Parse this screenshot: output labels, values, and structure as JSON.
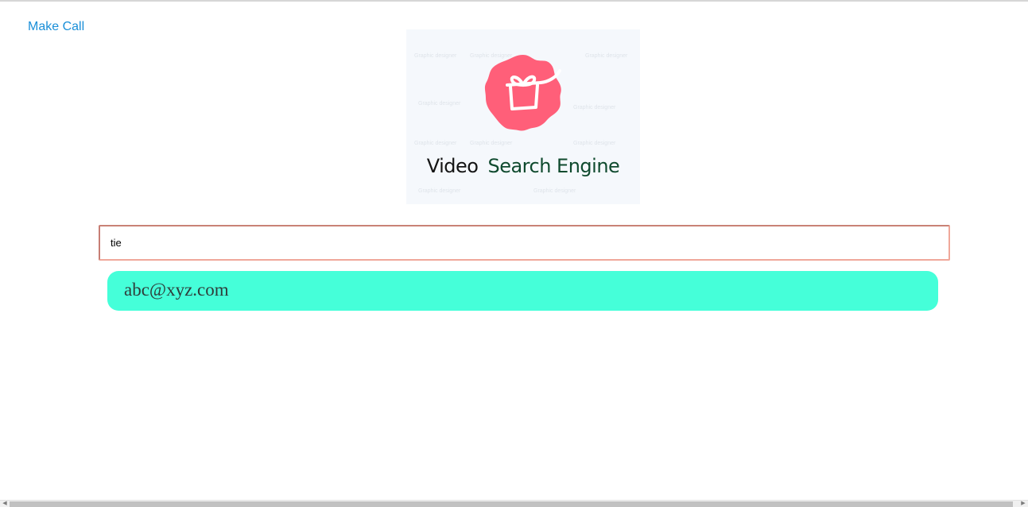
{
  "nav": {
    "make_call_label": "Make Call"
  },
  "logo": {
    "word1": "Video",
    "word2": "Search Engine",
    "badge_color": "#ff5f79",
    "watermark_text": "Graphic designer"
  },
  "search": {
    "value": "tie"
  },
  "results": [
    {
      "label": "abc@xyz.com"
    }
  ],
  "colors": {
    "link": "#1a8fd8",
    "result_bg": "#45ffd9",
    "input_border": "#f0a89a"
  }
}
